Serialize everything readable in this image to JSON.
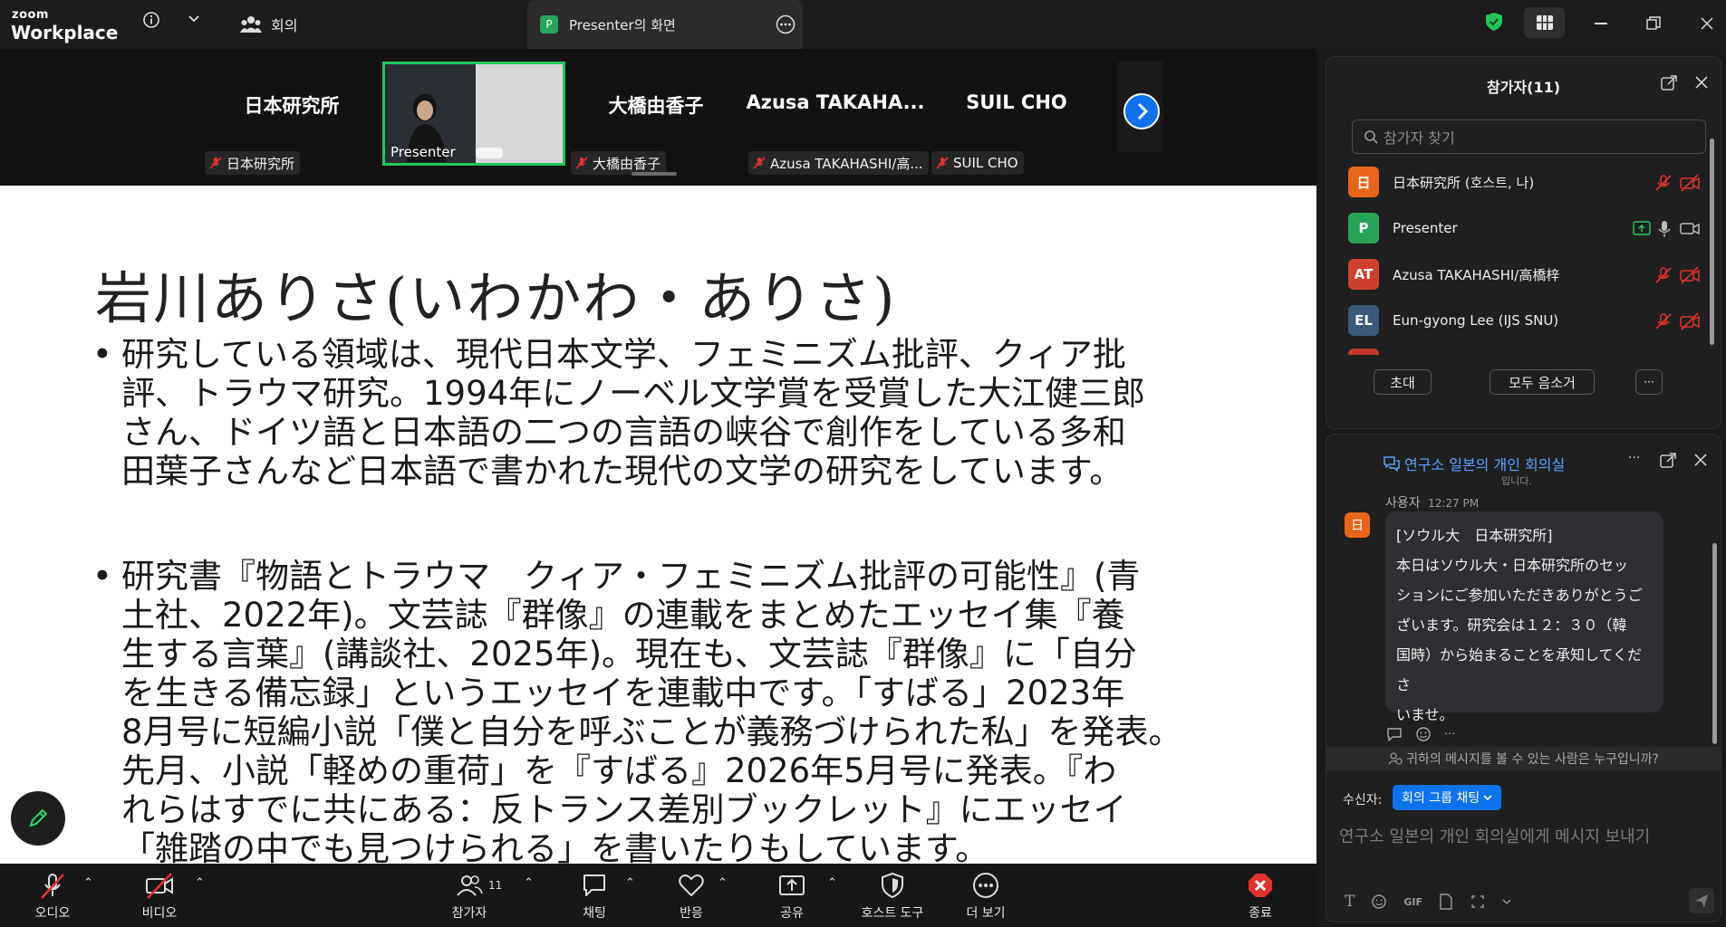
{
  "titlebar": {
    "logo_small": "zoom",
    "logo_big": "Workplace",
    "meeting_tab": "회의",
    "share_tab_badge": "P",
    "share_tab": "Presenter의 화면"
  },
  "strip": {
    "tiles": [
      {
        "name": "日本研究所",
        "tag": "日本研究所"
      },
      {
        "name": "",
        "tag": "Presenter"
      },
      {
        "name": "大橋由香子",
        "tag": "大橋由香子"
      },
      {
        "name": "Azusa  TAKAHA...",
        "tag": "Azusa TAKAHASHI/高..."
      },
      {
        "name": "SUIL CHO",
        "tag": "SUIL CHO"
      }
    ]
  },
  "slide": {
    "title": "岩川ありさ(いわかわ・ありさ)",
    "bullet_char": "•",
    "bullet1": "研究している領域は、現代日本文学、フェミニズム批評、クィア批\n評、トラウマ研究。1994年にノーベル文学賞を受賞した大江健三郎\nさん、ドイツ語と日本語の二つの言語の峡谷で創作をしている多和\n田葉子さんなど日本語で書かれた現代の文学の研究をしています。",
    "bullet2": "研究書『物語とトラウマ　クィア・フェミニズム批評の可能性』(青\n土社、2022年)。文芸誌『群像』の連載をまとめたエッセイ集『養\n生する言葉』(講談社、2025年)。現在も、文芸誌『群像』に「自分\nを生きる備忘録」というエッセイを連載中です。「すばる」2023年\n8月号に短編小説「僕と自分を呼ぶことが義務づけられた私」を発表。\n先月、小説「軽めの重荷」を『すばる』2026年5月号に発表。『わ\nれらはすでに共にある：反トランス差別ブックレット』にエッセイ\n「雑踏の中でも見つけられる」を書いたりもしています。"
  },
  "toolbar": {
    "audio": "오디오",
    "video": "비디오",
    "participants": "참가자",
    "participants_count": "11",
    "chat": "채팅",
    "react": "반응",
    "share": "공유",
    "host_tools": "호스트 도구",
    "more": "더 보기",
    "end": "종료"
  },
  "participants_panel": {
    "title": "참가자(11)",
    "search_placeholder": "참가자 찾기",
    "items": [
      {
        "initials": "日",
        "name": "日本研究所 (호스트, 나)",
        "color": "#e8661c"
      },
      {
        "initials": "P",
        "name": "Presenter",
        "color": "#27a35a"
      },
      {
        "initials": "AT",
        "name": "Azusa TAKAHASHI/高橋梓",
        "color": "#d0402f"
      },
      {
        "initials": "EL",
        "name": "Eun-gyong Lee (IJS SNU)",
        "color": "#3c5878"
      }
    ],
    "invite": "초대",
    "mute_all": "모두 음소거",
    "more": "···"
  },
  "chat_panel": {
    "title": "연구소 일본의 개인 회의실",
    "cut_text": "입니다.",
    "sender": "사용자",
    "time": "12:27 PM",
    "sender_initial": "日",
    "message": "[ソウル大　日本研究所]\n本日はソウル大・日本研究所のセッ\nションにご参加いただきありがとうご\nざいます。研究会は１２：３０（韓\n国時）から始まることを承知してくださ\nいませ。",
    "who_can_see": "귀하의 메시지를 볼 수 있는 사람은 누구입니까?",
    "to_label": "수신자:",
    "to_value": "회의 그룹 채팅",
    "input_placeholder": "연구소 일본의 개인 회의실에게 메시지 보내기",
    "gif": "GIF"
  },
  "colors": {
    "accent_blue": "#0e72ed",
    "active_speaker": "#22c55e",
    "end_red": "#e0312e",
    "muted_red": "#e0312e"
  }
}
